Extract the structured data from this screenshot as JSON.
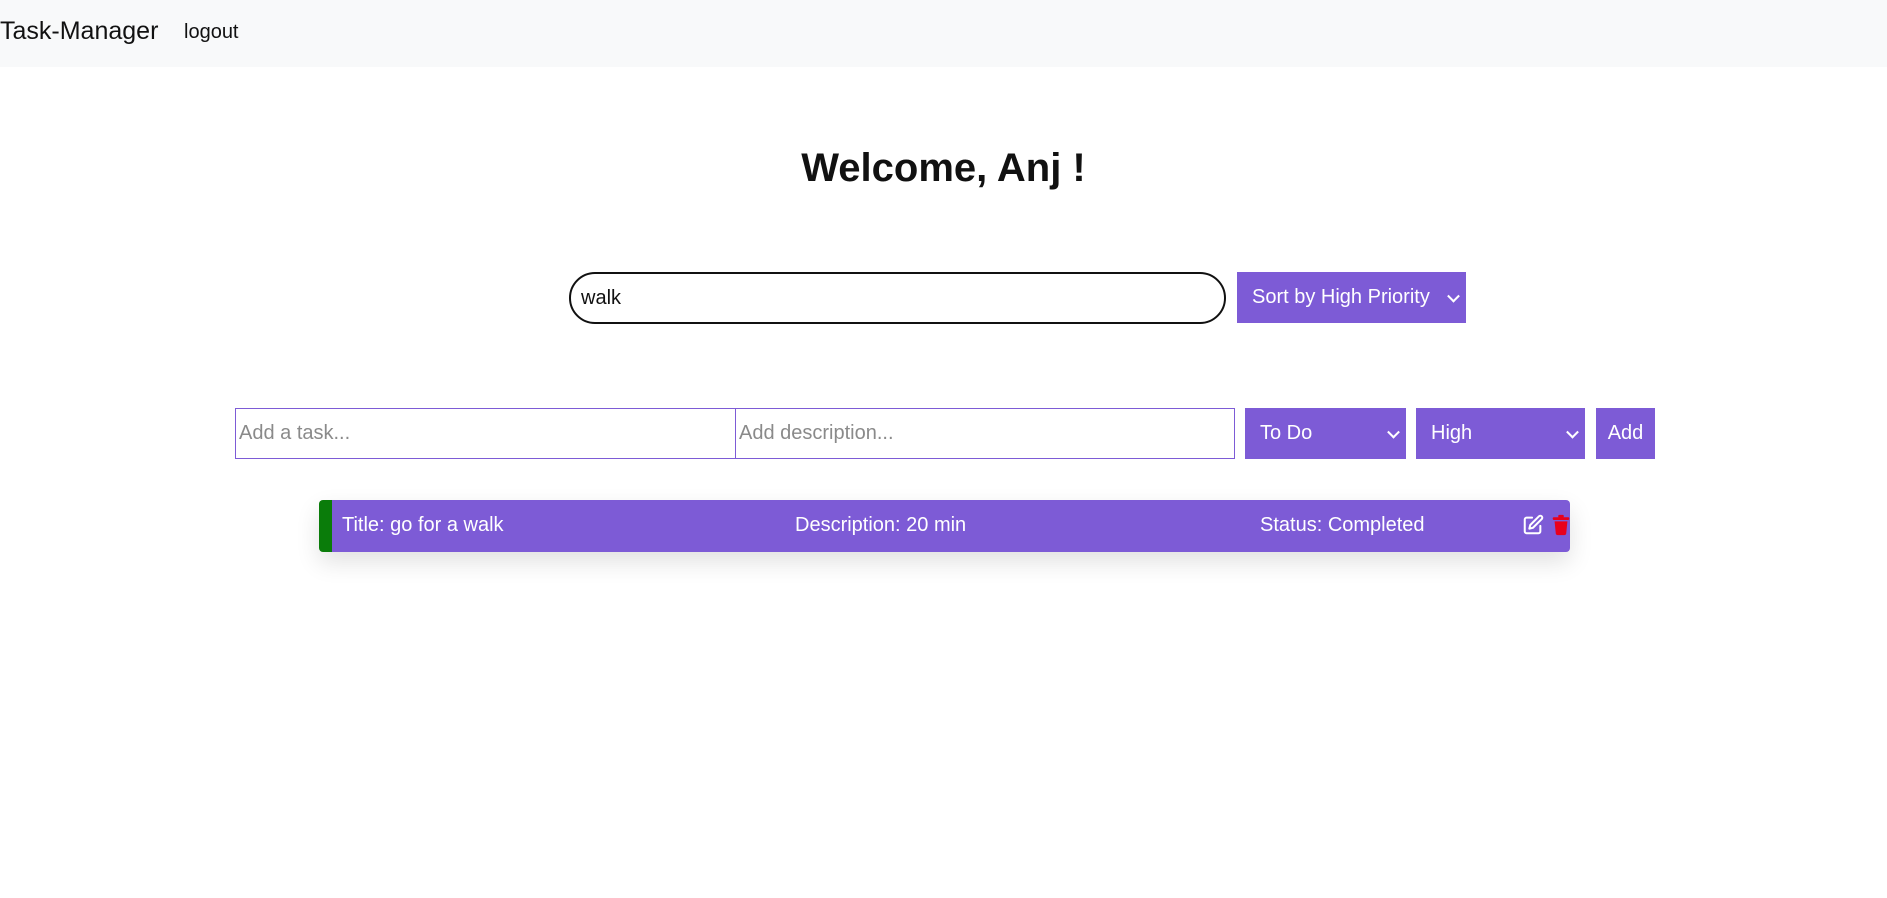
{
  "navbar": {
    "brand": "Task-Manager",
    "logout_label": "logout"
  },
  "welcome": {
    "heading": "Welcome, Anj !"
  },
  "search": {
    "value": "walk"
  },
  "sort": {
    "selected": "Sort by High Priority"
  },
  "new_task": {
    "title_placeholder": "Add a task...",
    "description_placeholder": "Add description...",
    "status_selected": "To Do",
    "priority_selected": "High",
    "add_label": "Add"
  },
  "tasks": [
    {
      "title": "Title: go for a walk",
      "description": "Description: 20 min",
      "status": "Status: Completed"
    }
  ],
  "colors": {
    "accent": "#7d5bd6",
    "completed_marker": "#0a7c0a",
    "delete": "#e8001c",
    "navbar_bg": "#f8f9fa"
  },
  "icons": {
    "edit": "edit-icon",
    "delete": "trash-icon"
  }
}
